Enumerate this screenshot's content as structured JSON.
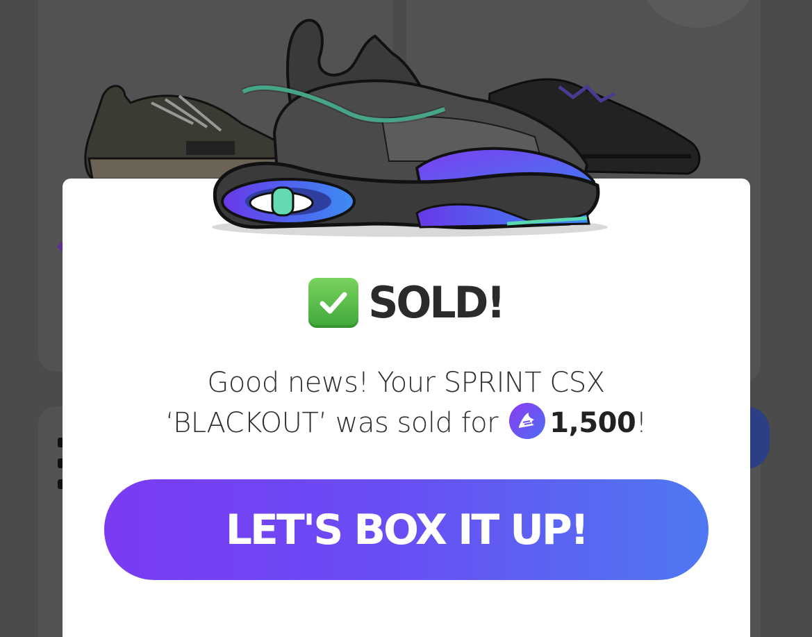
{
  "modal": {
    "status_icon": "check-mark-button-icon",
    "title": "SOLD!",
    "message_line1": "Good news! Your SPRINT CSX",
    "message_line2_prefix": "‘BLACKOUT’ was sold for",
    "coin_icon": "coin-icon",
    "amount": "1,500",
    "message_suffix": "!",
    "cta_label": "LET'S BOX IT UP!"
  },
  "colors": {
    "check_green": "#4fb848",
    "cta_start": "#7a3bf2",
    "cta_end": "#4f78f2",
    "overlay": "#4b4b4b"
  }
}
